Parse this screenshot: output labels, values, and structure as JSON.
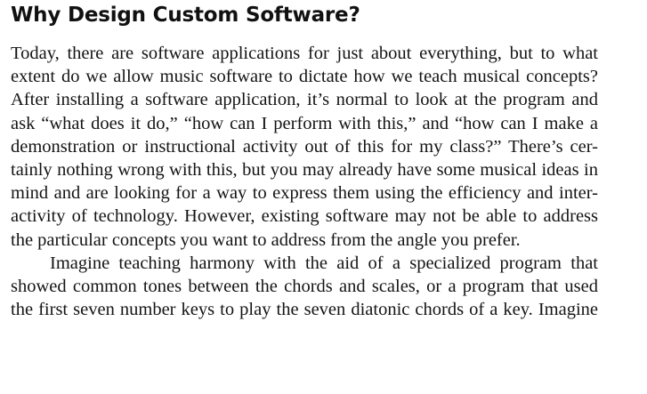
{
  "heading": "Why Design Custom Software?",
  "paragraphs": [
    [
      "Today, there are software applications for just about everything, but to what",
      "extent do we allow music software to dictate how we teach musical concepts?",
      "After installing a software application, it’s normal to look at the program and",
      "ask “what does it do,” “how can I perform with this,” and “how can I make a",
      "demonstration or instructional activity out of this for my class?” There’s cer-",
      "tainly nothing wrong with this, but you may already have some musical ideas in",
      "mind and are looking for a way to express them using the efficiency and inter-",
      "activity of technology. However, existing software may not be able to address",
      "the particular concepts you want to address from the angle you prefer."
    ],
    [
      "Imagine teaching harmony with the aid of a specialized program that",
      "showed common tones between the chords and scales, or a program that used",
      "the first seven number keys to play the seven diatonic chords of a key. Imagine"
    ]
  ]
}
